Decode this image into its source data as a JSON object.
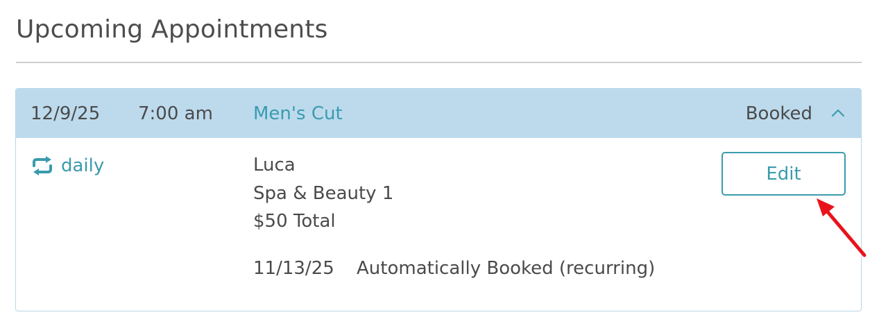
{
  "page": {
    "title": "Upcoming Appointments"
  },
  "appointment": {
    "date": "12/9/25",
    "time": "7:00 am",
    "service": "Men's Cut",
    "status": "Booked",
    "recurrence": "daily",
    "staff": "Luca",
    "location": "Spa & Beauty 1",
    "total": "$50 Total",
    "edit_label": "Edit",
    "history": {
      "date": "11/13/25",
      "note": "Automatically Booked (recurring)"
    }
  },
  "icons": {
    "collapse": "chevron-up-icon",
    "recurrence": "repeat-icon",
    "annotation": "red-arrow-icon"
  },
  "colors": {
    "accent": "#3a9bad",
    "header_bg": "#bddaed",
    "annotation": "#e8141b"
  }
}
